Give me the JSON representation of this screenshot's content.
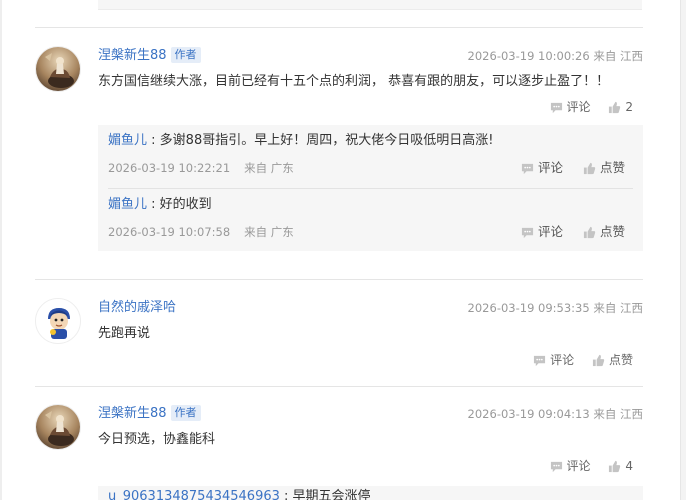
{
  "colors": {
    "link": "#3b73c4",
    "tag_bg": "#e5edf8",
    "meta": "#999999",
    "reply_bg": "#f6f6f6"
  },
  "comments": [
    {
      "username": "涅槃新生88",
      "badge": "作者",
      "time": "2026-03-19 10:00:26",
      "location": "来自 江西",
      "content": "东方国信继续大涨，目前已经有十五个点的利润， 恭喜有跟的朋友，可以逐步止盈了！！",
      "comment_label": "评论",
      "like_count": "2",
      "avatar_icon": "rider-avatar-icon",
      "replies": [
        {
          "username": "媚鱼儿",
          "text": "多谢88哥指引。早上好！周四，祝大佬今日吸低明日高涨!",
          "time": "2026-03-19 10:22:21",
          "location": "来自 广东",
          "comment_label": "评论",
          "like_label": "点赞"
        },
        {
          "username": "媚鱼儿",
          "text": "好的收到",
          "time": "2026-03-19 10:07:58",
          "location": "来自 广东",
          "comment_label": "评论",
          "like_label": "点赞"
        }
      ]
    },
    {
      "username": "自然的戚泽哈",
      "time": "2026-03-19 09:53:35",
      "location": "来自 江西",
      "content": "先跑再说",
      "comment_label": "评论",
      "like_label": "点赞",
      "avatar_icon": "cartoon-avatar-icon"
    },
    {
      "username": "涅槃新生88",
      "badge": "作者",
      "time": "2026-03-19 09:04:13",
      "location": "来自 江西",
      "content": "今日预选，协鑫能科",
      "comment_label": "评论",
      "like_count": "4",
      "avatar_icon": "rider-avatar-icon",
      "partial_reply": {
        "username": "u_9063134875434546963",
        "text": "早期五会涨停"
      }
    }
  ]
}
